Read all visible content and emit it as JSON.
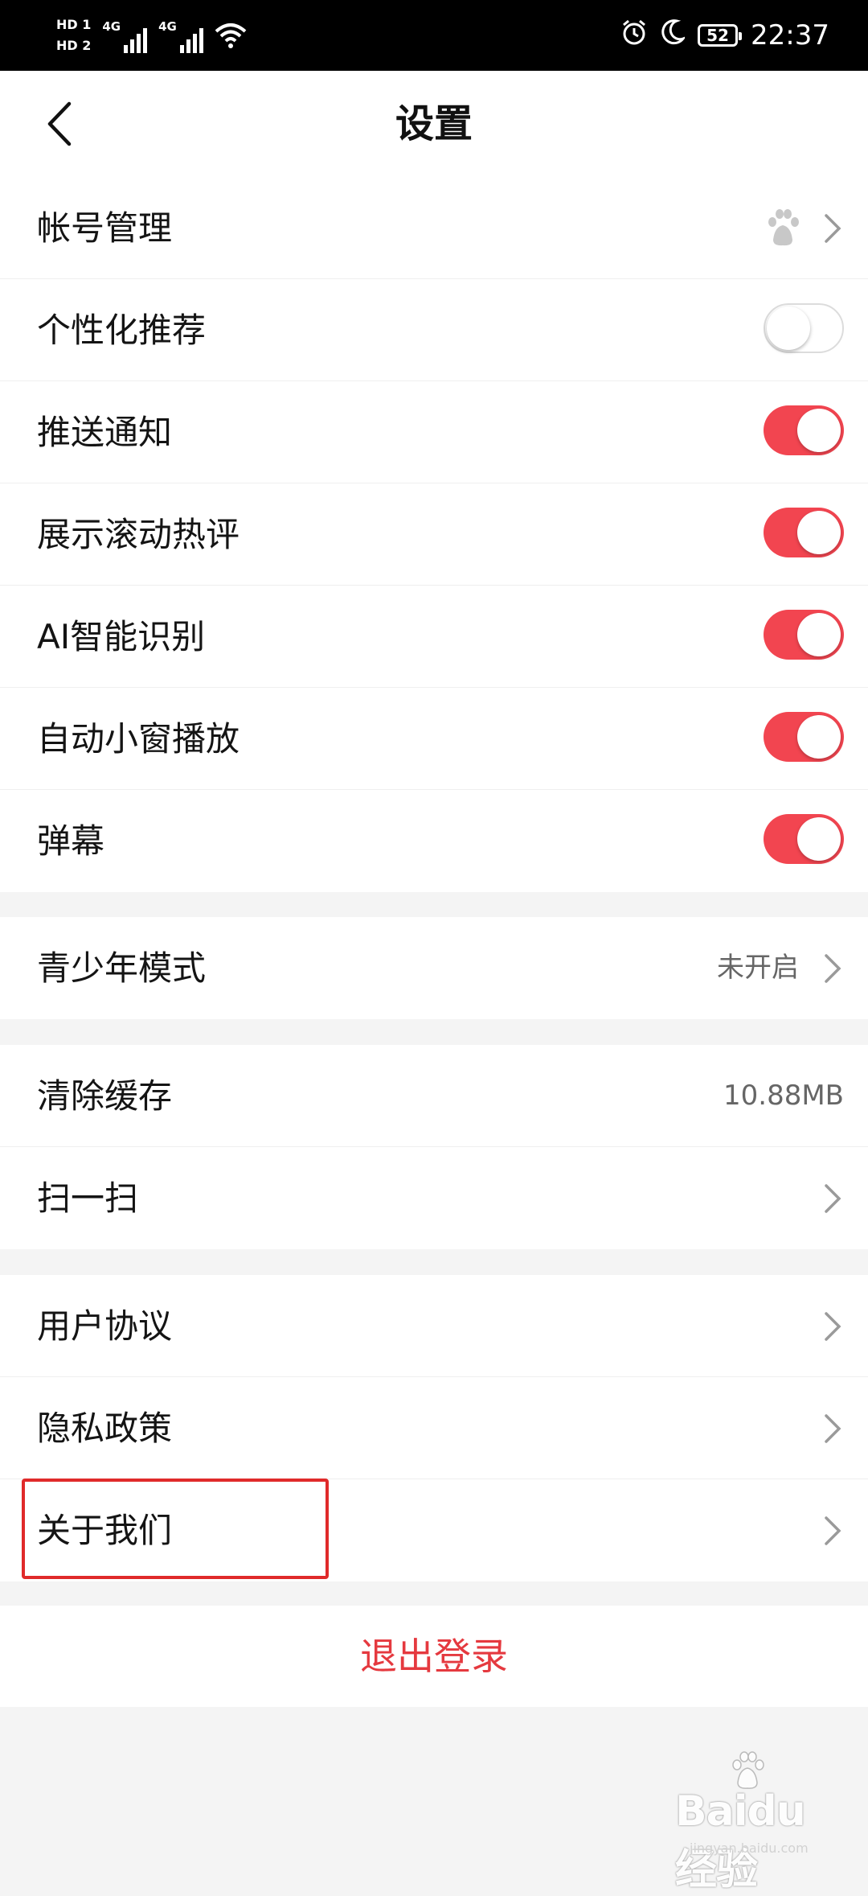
{
  "status_bar": {
    "hd1": "HD 1",
    "hd2": "HD 2",
    "net1": "4G",
    "net2": "4G",
    "battery": "52",
    "time": "22:37"
  },
  "header": {
    "title": "设置"
  },
  "groups": {
    "main": [
      {
        "label": "帐号管理"
      },
      {
        "label": "个性化推荐",
        "toggle": false
      },
      {
        "label": "推送通知",
        "toggle": true
      },
      {
        "label": "展示滚动热评",
        "toggle": true
      },
      {
        "label": "AI智能识别",
        "toggle": true
      },
      {
        "label": "自动小窗播放",
        "toggle": true
      },
      {
        "label": "弹幕",
        "toggle": true
      }
    ],
    "youth": {
      "label": "青少年模式",
      "value": "未开启"
    },
    "cache": {
      "label": "清除缓存",
      "value": "10.88MB"
    },
    "scan": {
      "label": "扫一扫"
    },
    "user_agreement": {
      "label": "用户协议"
    },
    "privacy": {
      "label": "隐私政策"
    },
    "about": {
      "label": "关于我们"
    }
  },
  "logout": {
    "label": "退出登录"
  },
  "watermark": {
    "brand": "Baidu经验",
    "url": "jingyan.baidu.com"
  },
  "colors": {
    "accent": "#f24550",
    "logout": "#e5393f",
    "highlight": "#e02a2a"
  }
}
